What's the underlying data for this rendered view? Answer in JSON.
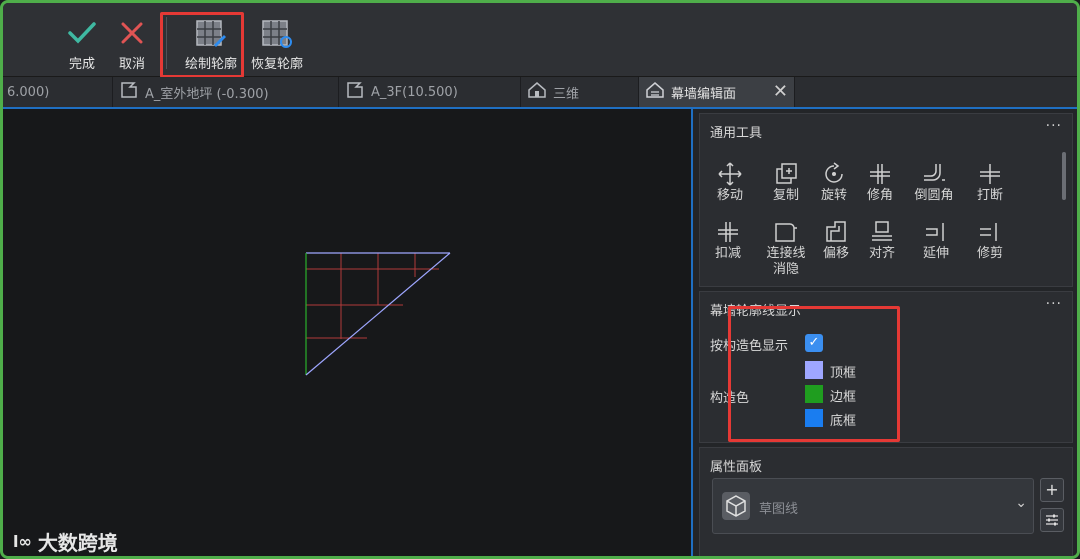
{
  "toolbar": {
    "finish_label": "完成",
    "cancel_label": "取消",
    "draw_outline_label": "绘制轮廓",
    "restore_outline_label": "恢复轮廓"
  },
  "tabs": [
    {
      "label": "6.000)"
    },
    {
      "label": "A_室外地坪 (-0.300)"
    },
    {
      "label": "A_3F(10.500)"
    },
    {
      "label": "三维"
    },
    {
      "label": "幕墙编辑面",
      "active": true
    }
  ],
  "panel": {
    "general_tools": {
      "title": "通用工具",
      "more": "···",
      "row1": [
        "移动",
        "复制",
        "旋转",
        "修角",
        "倒圆角",
        "打断"
      ],
      "row2": [
        {
          "l1": "扣减",
          "l2": ""
        },
        {
          "l1": "连接线",
          "l2": "消隐"
        },
        {
          "l1": "偏移",
          "l2": ""
        },
        {
          "l1": "对齐",
          "l2": ""
        },
        {
          "l1": "延伸",
          "l2": ""
        },
        {
          "l1": "修剪",
          "l2": ""
        }
      ]
    },
    "curtain_display": {
      "title": "幕墙轮廓线显示",
      "more": "···",
      "by_color_label": "按构造色显示",
      "by_color_checked": true,
      "check_mark": "✓",
      "color_label": "构造色",
      "items": [
        {
          "label": "顶框",
          "color": "#9ea6ff"
        },
        {
          "label": "边框",
          "color": "#1f9d1f"
        },
        {
          "label": "底框",
          "color": "#1a7df0"
        }
      ]
    },
    "properties": {
      "title": "属性面板",
      "placeholder": "草图线",
      "add": "+"
    }
  },
  "watermark": {
    "logo": "l∞",
    "text": "大数跨境"
  }
}
